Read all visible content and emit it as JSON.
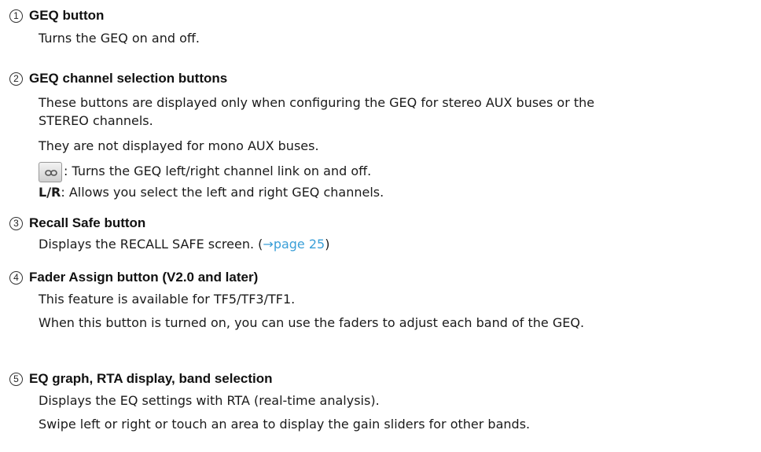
{
  "items": [
    {
      "num": "1",
      "title": "GEQ button",
      "lines": [
        "Turns the GEQ on and off."
      ]
    },
    {
      "num": "2",
      "title": "GEQ channel selection buttons",
      "lines": [
        "These buttons are displayed only when configuring the GEQ for stereo AUX buses or the",
        "STEREO channels.",
        "They are not displayed for mono AUX buses."
      ],
      "link_line": ": Turns the GEQ left/right channel link on and off.",
      "lr_label": "L/R",
      "lr_text": ": Allows you select the left and right GEQ channels."
    },
    {
      "num": "3",
      "title": "Recall Safe button",
      "line_prefix": "Displays the RECALL SAFE screen. (",
      "line_link": "→page 25",
      "line_suffix": ")"
    },
    {
      "num": "4",
      "title": "Fader Assign button (V2.0 and later)",
      "lines": [
        "This feature is available for TF5/TF3/TF1.",
        "When this button is turned on, you can use the faders to adjust each band of the GEQ."
      ]
    },
    {
      "num": "5",
      "title": "EQ graph, RTA display, band selection",
      "lines": [
        "Displays the EQ settings with RTA (real-time analysis).",
        "Swipe left or right or touch an area to display the gain sliders for other bands."
      ]
    }
  ],
  "icons": {
    "link_button": "chain-link-icon"
  }
}
